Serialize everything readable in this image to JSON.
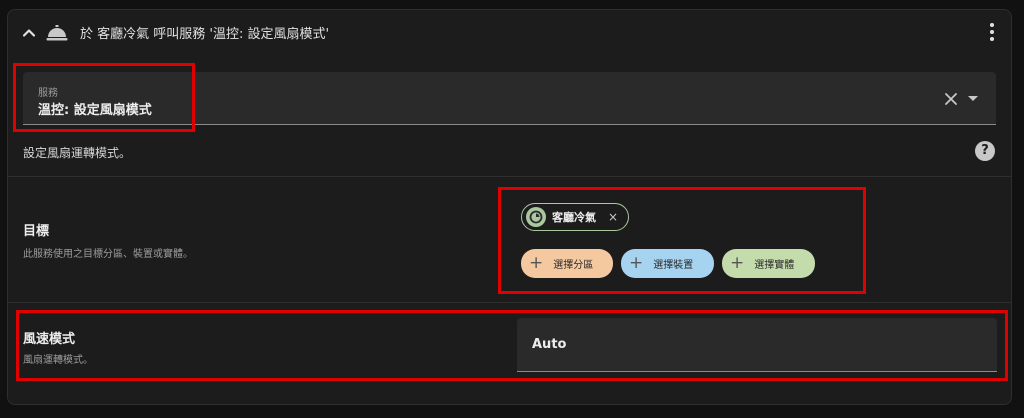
{
  "header": {
    "title": "於 客廳冷氣 呼叫服務 '溫控: 設定風扇模式'",
    "chevron_icon": "chevron-up-icon",
    "service_icon": "bell-concierge-icon",
    "menu_icon": "kebab-menu-icon"
  },
  "service_field": {
    "caption": "服務",
    "value": "溫控: 設定風扇模式"
  },
  "service_description": "設定風扇運轉模式。",
  "help_glyph": "?",
  "target": {
    "label": "目標",
    "sublabel": "此服務使用之目標分區、裝置或實體。",
    "selected_entity": "客廳冷氣",
    "remove_glyph": "×",
    "buttons": {
      "area": "選擇分區",
      "device": "選擇裝置",
      "entity": "選擇實體",
      "plus_glyph": "+"
    }
  },
  "fan_mode": {
    "label": "風速模式",
    "sublabel": "風扇運轉模式。",
    "value": "Auto"
  },
  "colors": {
    "highlight": "#e00000",
    "area_chip": "#f4c9a0",
    "device_chip": "#a6d3f0",
    "entity_chip": "#c4dbab",
    "entity_outline": "#a9c8a0"
  }
}
